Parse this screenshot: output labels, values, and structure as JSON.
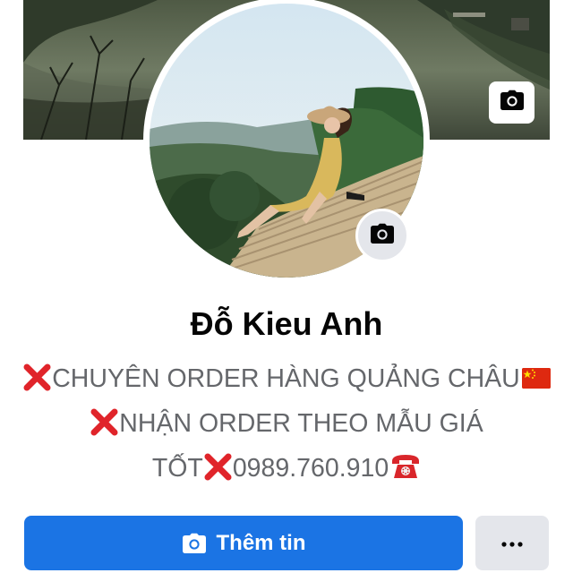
{
  "profile": {
    "name": "Đỗ Kieu Anh",
    "bio": {
      "line1": "CHUYÊN ORDER HÀNG QUẢNG CHÂU",
      "line2": "NHẬN ORDER THEO MẪU GIÁ",
      "line3_a": "TỐT",
      "line3_b": "0989.760.910"
    }
  },
  "actions": {
    "add_story_label": "Thêm tin"
  },
  "icons": {
    "cover_camera": "camera-icon",
    "avatar_camera": "camera-icon",
    "bio_marker": "cross-mark-icon",
    "flag": "china-flag-icon",
    "phone": "telephone-icon",
    "more": "more-horizontal-icon"
  },
  "colors": {
    "primary_button": "#1b74e4",
    "secondary_button": "#e4e6eb",
    "bio_text": "#65676b",
    "name_text": "#050505",
    "cross_mark": "#e0242a"
  }
}
